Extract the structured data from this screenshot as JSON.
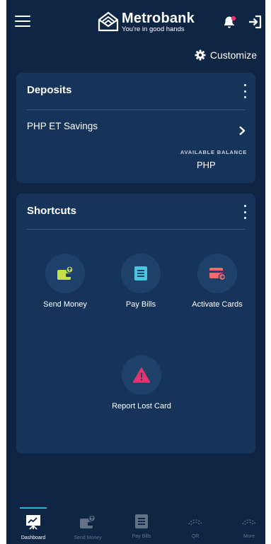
{
  "header": {
    "brand_name": "Metrobank",
    "brand_tagline": "You're in good hands"
  },
  "customize": {
    "label": "Customize"
  },
  "deposits": {
    "title": "Deposits",
    "account_name": "PHP ET Savings",
    "balance_label": "AVAILABLE BALANCE",
    "balance_value": "PHP"
  },
  "shortcuts": {
    "title": "Shortcuts",
    "items": [
      {
        "label": "Send Money",
        "icon": "wallet-icon",
        "color": "#c7e04a"
      },
      {
        "label": "Pay Bills",
        "icon": "bill-icon",
        "color": "#4cc6e0"
      },
      {
        "label": "Activate Cards",
        "icon": "card-icon",
        "color": "#f26b6b"
      },
      {
        "label": "Report Lost Card",
        "icon": "warning-icon",
        "color": "#e5336f"
      }
    ]
  },
  "bottom_nav": {
    "items": [
      {
        "label": "Dashboard",
        "icon": "dashboard-icon",
        "active": true
      },
      {
        "label": "Send Money",
        "icon": "wallet-icon",
        "active": false
      },
      {
        "label": "Pay Bills",
        "icon": "bill-icon",
        "active": false
      },
      {
        "label": "QR",
        "icon": "qr-icon",
        "active": false
      },
      {
        "label": "More",
        "icon": "more-icon",
        "active": false
      }
    ]
  },
  "colors": {
    "background": "#0e2643",
    "card": "#16345a",
    "shortcut_circle": "#1e4169",
    "accent": "#2bb3d6",
    "notification_dot": "#e5336f"
  }
}
